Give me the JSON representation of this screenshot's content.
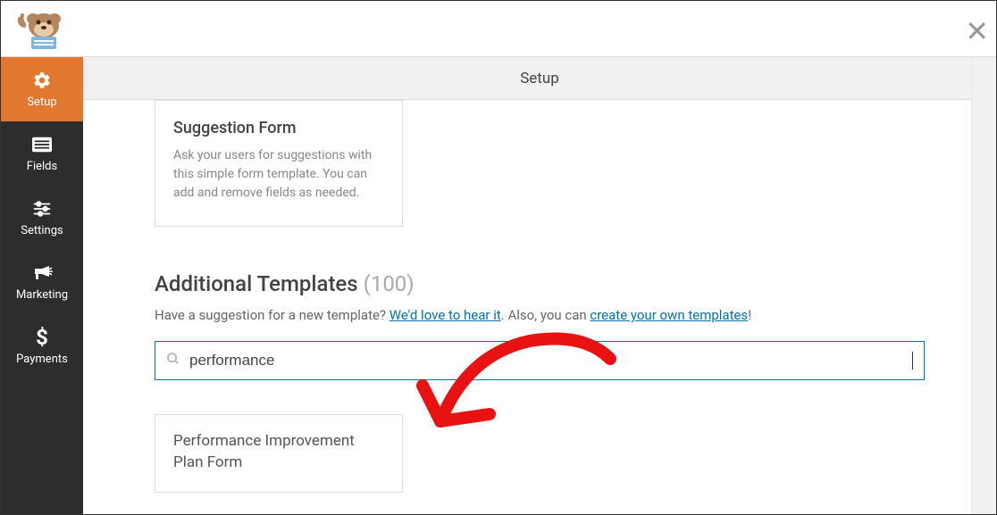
{
  "header": {
    "tab_title": "Setup"
  },
  "sidebar": {
    "items": [
      {
        "label": "Setup",
        "icon": "gear",
        "active": true
      },
      {
        "label": "Fields",
        "icon": "list",
        "active": false
      },
      {
        "label": "Settings",
        "icon": "sliders",
        "active": false
      },
      {
        "label": "Marketing",
        "icon": "bullhorn",
        "active": false
      },
      {
        "label": "Payments",
        "icon": "dollar",
        "active": false
      }
    ]
  },
  "suggestion_card": {
    "title": "Suggestion Form",
    "description": "Ask your users for suggestions with this simple form template. You can add and remove fields as needed."
  },
  "additional": {
    "title": "Additional Templates",
    "count": "(100)",
    "prompt_pre": "Have a suggestion for a new template? ",
    "link1": "We'd love to hear it",
    "prompt_mid": ". Also, you can ",
    "link2": "create your own templates",
    "prompt_end": "!"
  },
  "search": {
    "value": "performance",
    "placeholder": ""
  },
  "result": {
    "title": "Performance Improvement Plan Form"
  }
}
